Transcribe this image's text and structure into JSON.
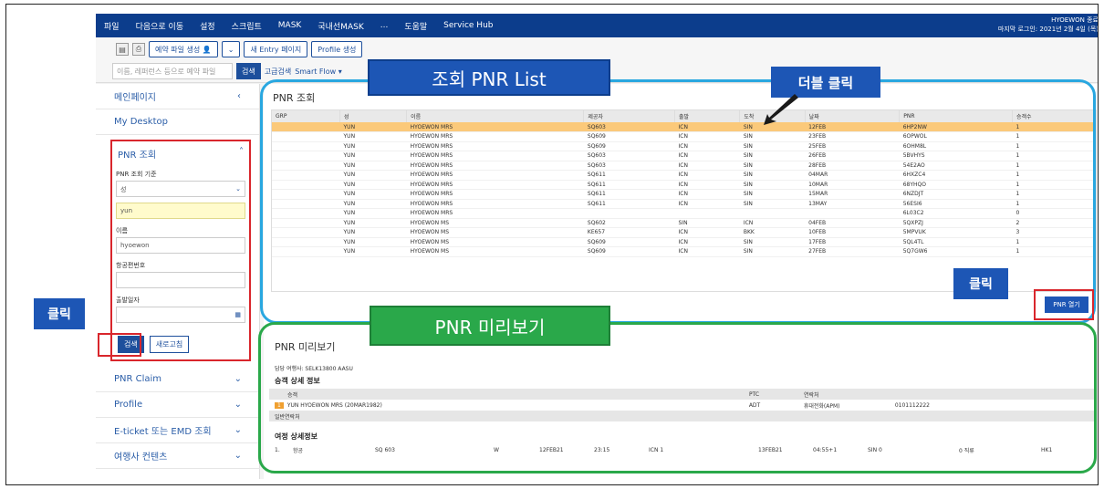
{
  "menu": [
    "파일",
    "다음으로 이동",
    "설정",
    "스크립트",
    "MASK",
    "국내선MASK",
    "...",
    "도움말",
    "Service Hub"
  ],
  "user": {
    "name": "HYOEWON 종료",
    "login": "마지막 로그인: 2021년 2월 4일 (목)"
  },
  "toolbar": {
    "booking_file": "예약 파일 생성",
    "new_entry": "새 Entry 페이지",
    "profile": "Profile 생성",
    "search_placeholder": "이름, 레퍼런스 등으로 예약 파일",
    "search_button": "검색",
    "advanced": "고급검색",
    "smartflow": "Smart Flow ▾"
  },
  "sidebar": {
    "main": "메인페이지",
    "desktop": "My Desktop",
    "pnr_title": "PNR 조회",
    "criteria_label": "PNR 조회 기준",
    "criteria_value": "성",
    "surname_value": "yun",
    "name_label": "이름",
    "name_value": "hyoewon",
    "flight_label": "항공편번호",
    "date_label": "출발일자",
    "search_btn": "검색",
    "refresh_btn": "새로고침",
    "items": [
      "PNR Claim",
      "Profile",
      "E-ticket 또는 EMD 조회",
      "여행사 컨텐츠"
    ]
  },
  "pnr_list": {
    "title": "PNR 조회",
    "headers": [
      "GRP",
      "성",
      "이름",
      "제공자",
      "출발",
      "도착",
      "날짜",
      "PNR",
      "승객수"
    ],
    "rows": [
      [
        "",
        "YUN",
        "HYOEWON MRS",
        "SQ603",
        "ICN",
        "SIN",
        "12FEB",
        "6HP2NW",
        "1"
      ],
      [
        "",
        "YUN",
        "HYOEWON MRS",
        "SQ609",
        "ICN",
        "SIN",
        "23FEB",
        "6OPWOL",
        "1"
      ],
      [
        "",
        "YUN",
        "HYOEWON MRS",
        "SQ609",
        "ICN",
        "SIN",
        "25FEB",
        "6OHM8L",
        "1"
      ],
      [
        "",
        "YUN",
        "HYOEWON MRS",
        "SQ603",
        "ICN",
        "SIN",
        "26FEB",
        "5BVHYS",
        "1"
      ],
      [
        "",
        "YUN",
        "HYOEWON MRS",
        "SQ603",
        "ICN",
        "SIN",
        "28FEB",
        "54E2AO",
        "1"
      ],
      [
        "",
        "YUN",
        "HYOEWON MRS",
        "SQ611",
        "ICN",
        "SIN",
        "04MAR",
        "6HXZC4",
        "1"
      ],
      [
        "",
        "YUN",
        "HYOEWON MRS",
        "SQ611",
        "ICN",
        "SIN",
        "10MAR",
        "68YHQO",
        "1"
      ],
      [
        "",
        "YUN",
        "HYOEWON MRS",
        "SQ611",
        "ICN",
        "SIN",
        "15MAR",
        "6NZDJT",
        "1"
      ],
      [
        "",
        "YUN",
        "HYOEWON MRS",
        "SQ611",
        "ICN",
        "SIN",
        "13MAY",
        "56ESI6",
        "1"
      ],
      [
        "",
        "YUN",
        "HYOEWON MRS",
        "",
        "",
        "",
        "",
        "6L03C2",
        "0"
      ],
      [
        "",
        "YUN",
        "HYOEWON MS",
        "SQ602",
        "SIN",
        "ICN",
        "04FEB",
        "5QXPZJ",
        "2"
      ],
      [
        "",
        "YUN",
        "HYOEWON MS",
        "KE657",
        "ICN",
        "BKK",
        "10FEB",
        "5MPVUK",
        "3"
      ],
      [
        "",
        "YUN",
        "HYOEWON MS",
        "SQ609",
        "ICN",
        "SIN",
        "17FEB",
        "5QL4TL",
        "1"
      ],
      [
        "",
        "YUN",
        "HYOEWON MS",
        "SQ609",
        "ICN",
        "SIN",
        "27FEB",
        "5Q7GW6",
        "1"
      ]
    ],
    "open_button": "PNR 열기"
  },
  "preview": {
    "title": "PNR 미리보기",
    "agency": "담당 여행사: SELK13800 AASU",
    "passenger_section": "승객 상세 정보",
    "pax_headers": [
      "승객",
      "PTC",
      "연락처"
    ],
    "pax_row": {
      "num": "1",
      "name": "YUN HYOEWON MRS (20MAR1982)",
      "ptc": "ADT",
      "contact": "휴대전화(APM)",
      "phone": "0101112222"
    },
    "general_contact": "일반연락처",
    "itinerary_section": "여정 상세정보",
    "itin_row": [
      "1.",
      "항공",
      "SQ 603",
      "W",
      "12FEB21",
      "23:15",
      "ICN 1",
      "13FEB21",
      "04:55+1",
      "SIN 0",
      "0 직류",
      "HK1"
    ]
  },
  "annotations": {
    "list_label": "조회 PNR List",
    "dblclick": "더블 클릭",
    "click_left": "클릭",
    "click_right": "클릭",
    "preview_label": "PNR 미리보기"
  },
  "colors": {
    "navy": "#0c3d8c",
    "accent": "#1d56b5",
    "blue_outline": "#29a7e0",
    "green_outline": "#2aa84a",
    "red_box": "#d9262c",
    "selected_row": "#fbc97a"
  }
}
